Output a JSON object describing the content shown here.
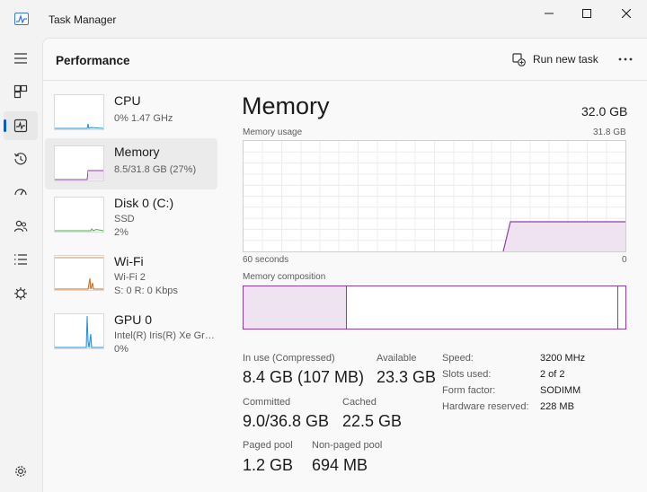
{
  "window": {
    "title": "Task Manager"
  },
  "nav": {
    "items": [
      {
        "icon": "hamburger-menu-icon"
      },
      {
        "icon": "processes-icon"
      },
      {
        "icon": "performance-icon",
        "active": true
      },
      {
        "icon": "app-history-icon"
      },
      {
        "icon": "startup-apps-icon"
      },
      {
        "icon": "users-icon"
      },
      {
        "icon": "details-icon"
      },
      {
        "icon": "services-icon"
      },
      {
        "icon": "settings-icon"
      }
    ]
  },
  "header": {
    "title": "Performance",
    "run_new_task": "Run new task"
  },
  "devices": [
    {
      "name": "CPU",
      "line1": "0%  1.47 GHz",
      "color": "#1f8fd6"
    },
    {
      "name": "Memory",
      "line1": "8.5/31.8 GB (27%)",
      "color": "#8e3fa4",
      "selected": true
    },
    {
      "name": "Disk 0 (C:)",
      "line1": "SSD",
      "line2": "2%",
      "color": "#4caf50"
    },
    {
      "name": "Wi-Fi",
      "line1": "Wi-Fi 2",
      "line2": "S: 0  R: 0 Kbps",
      "color": "#c96a1e"
    },
    {
      "name": "GPU 0",
      "line1": "Intel(R) Iris(R) Xe Graphics",
      "line2": "0%",
      "color": "#1f8fd6"
    }
  ],
  "detail": {
    "title": "Memory",
    "total": "32.0 GB",
    "usage_label": "Memory usage",
    "usage_max": "31.8 GB",
    "time_left": "60 seconds",
    "time_right": "0",
    "composition_label": "Memory composition",
    "in_use_fraction": 0.27,
    "stats": {
      "in_use_label": "In use (Compressed)",
      "in_use_value": "8.4 GB (107 MB)",
      "available_label": "Available",
      "available_value": "23.3 GB",
      "committed_label": "Committed",
      "committed_value": "9.0/36.8 GB",
      "cached_label": "Cached",
      "cached_value": "22.5 GB",
      "paged_label": "Paged pool",
      "paged_value": "1.2 GB",
      "nonpaged_label": "Non-paged pool",
      "nonpaged_value": "694 MB"
    },
    "specs": [
      {
        "key": "Speed:",
        "value": "3200 MHz"
      },
      {
        "key": "Slots used:",
        "value": "2 of 2"
      },
      {
        "key": "Form factor:",
        "value": "SODIMM"
      },
      {
        "key": "Hardware reserved:",
        "value": "228 MB"
      }
    ]
  },
  "colors": {
    "memory": "#8e3fa4",
    "memory_fill": "#efe3f2",
    "accent": "#0a5fb8"
  }
}
